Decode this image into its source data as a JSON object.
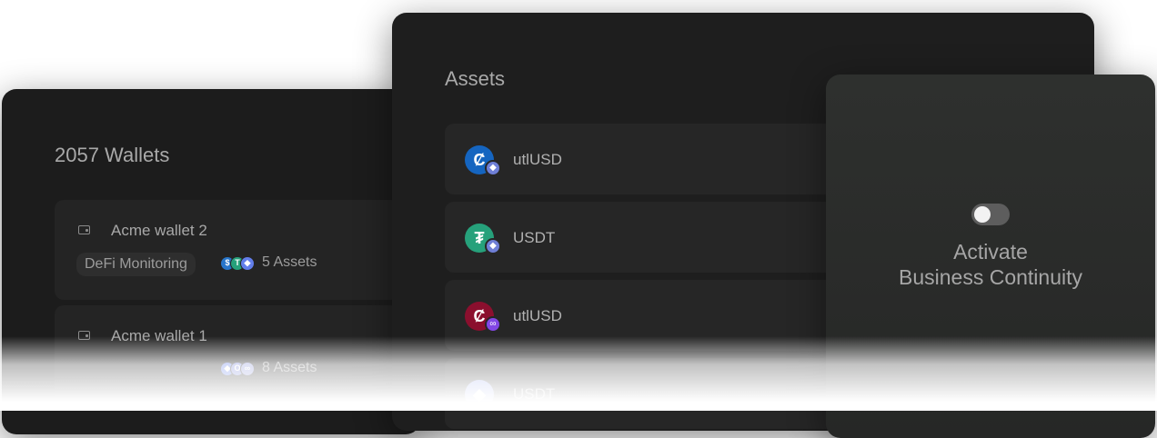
{
  "wallets": {
    "title": "2057 Wallets",
    "items": [
      {
        "name": "Acme wallet 2",
        "tag": "DeFi Monitoring",
        "assets_label": "5 Assets",
        "coin_icons": [
          "usdc-icon",
          "tether-icon",
          "ethereum-icon"
        ]
      },
      {
        "name": "Acme wallet 1",
        "tag": "",
        "assets_label": "8 Assets",
        "coin_icons": [
          "ethereum-icon",
          "bitcoin-icon",
          "link-icon"
        ]
      }
    ]
  },
  "assets": {
    "title": "Assets",
    "items": [
      {
        "name": "utlUSD",
        "icon": "utlusd-icon",
        "color": "#1565c0",
        "glyph": "Ȼ",
        "chain": "ethereum-icon",
        "chain_color": "#6f7fd6",
        "chain_glyph": "◆"
      },
      {
        "name": "USDT",
        "icon": "tether-icon",
        "color": "#26a17b",
        "glyph": "₮",
        "chain": "ethereum-icon",
        "chain_color": "#6f7fd6",
        "chain_glyph": "◆"
      },
      {
        "name": "utlUSD",
        "icon": "utlusd-icon",
        "color": "#8b0f2e",
        "glyph": "Ȼ",
        "chain": "polygon-icon",
        "chain_color": "#8247e5",
        "chain_glyph": "∞"
      },
      {
        "name": "USDT",
        "icon": "ethereum-icon",
        "color": "#8a9ae8",
        "glyph": "◆",
        "chain": "",
        "chain_color": "",
        "chain_glyph": ""
      }
    ]
  },
  "business_continuity": {
    "line1": "Activate",
    "line2": "Business Continuity",
    "toggle_on": false
  },
  "colors": {
    "card_bg": "#1d1d1d",
    "row_bg": "#262626",
    "text_muted": "#a9a9a9"
  }
}
